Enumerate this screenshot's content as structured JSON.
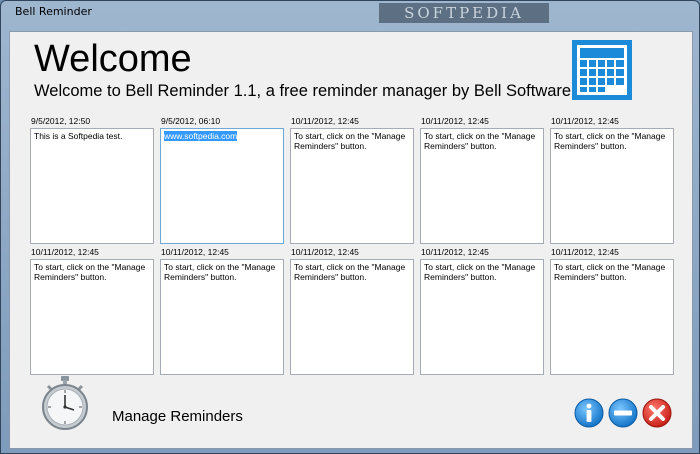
{
  "window": {
    "title": "Bell Reminder",
    "watermark": "SOFTPEDIA"
  },
  "header": {
    "title": "Welcome",
    "subtitle": "Welcome to Bell Reminder 1.1, a free reminder manager by Bell Software."
  },
  "notes": [
    {
      "timestamp": "9/5/2012, 12:50",
      "text": "This is a Softpedia test."
    },
    {
      "timestamp": "9/5/2012, 06:10",
      "text": "www.softpedia.com"
    },
    {
      "timestamp": "10/11/2012, 12:45",
      "text": "To start, click on the \"Manage Reminders\" button."
    },
    {
      "timestamp": "10/11/2012, 12:45",
      "text": "To start, click on the \"Manage Reminders\" button."
    },
    {
      "timestamp": "10/11/2012, 12:45",
      "text": "To start, click on the \"Manage Reminders\" button."
    },
    {
      "timestamp": "10/11/2012, 12:45",
      "text": "To start, click on the \"Manage Reminders\" button."
    },
    {
      "timestamp": "10/11/2012, 12:45",
      "text": "To start, click on the \"Manage Reminders\" button."
    },
    {
      "timestamp": "10/11/2012, 12:45",
      "text": "To start, click on the \"Manage Reminders\" button."
    },
    {
      "timestamp": "10/11/2012, 12:45",
      "text": "To start, click on the \"Manage Reminders\" button."
    },
    {
      "timestamp": "10/11/2012, 12:45",
      "text": "To start, click on the \"Manage Reminders\" button."
    }
  ],
  "footer": {
    "manage_label": "Manage Reminders"
  },
  "colors": {
    "accent": "#1e8fe0",
    "info": "#1e8fe0",
    "minimize": "#1e8fe0",
    "close": "#e0302a"
  },
  "icons": {
    "app": "calendar-icon",
    "manage": "stopwatch-icon",
    "info": "info-icon",
    "minimize": "minimize-icon",
    "close": "close-icon"
  }
}
